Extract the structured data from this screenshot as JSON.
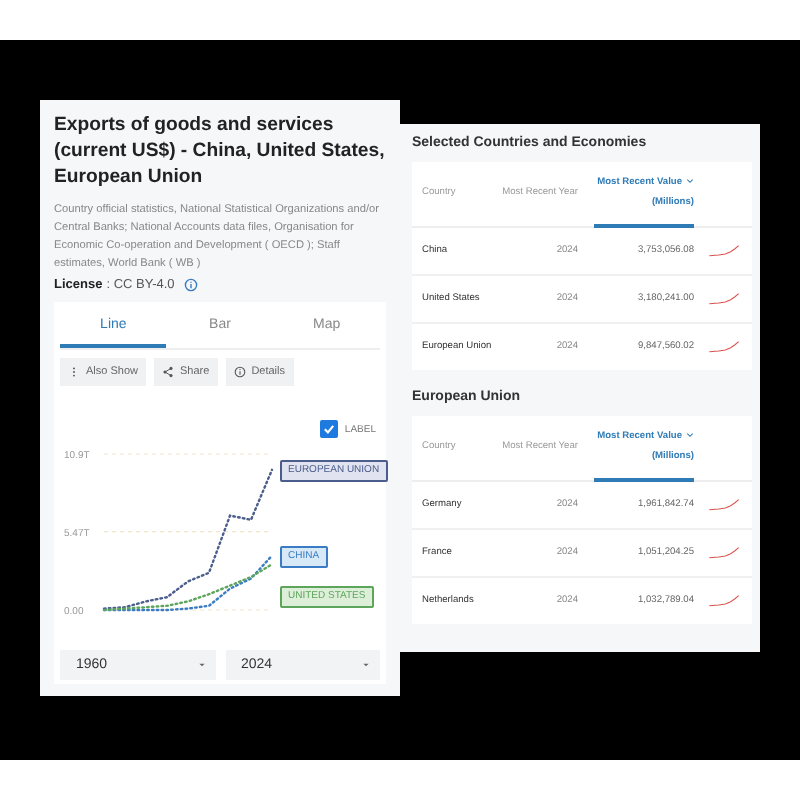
{
  "indicator": {
    "title": "Exports of goods and services (current US$) - China, United States, European Union",
    "source": "Country official statistics, National Statistical Organizations and/or Central Banks; National Accounts data files, Organisation for Economic Co-operation and Development ( OECD ); Staff estimates, World Bank ( WB )",
    "license_label": "License",
    "license_value": ": CC BY-4.0"
  },
  "view_tabs": [
    {
      "label": "Line",
      "selected": true
    },
    {
      "label": "Bar",
      "selected": false
    },
    {
      "label": "Map",
      "selected": false
    }
  ],
  "actions": [
    {
      "label": "Also Show",
      "kind": "more"
    },
    {
      "label": "Share",
      "kind": "share"
    },
    {
      "label": "Details",
      "kind": "details"
    }
  ],
  "label_toggle": {
    "label": "LABEL",
    "checked": true
  },
  "chart": {
    "chart_data": {
      "type": "line",
      "categories": [
        null,
        null,
        null,
        null,
        null,
        null,
        null,
        null,
        null
      ],
      "yticks": [
        {
          "value": 0,
          "label": "0.00"
        },
        {
          "value": 5.47,
          "label": "5.47T"
        },
        {
          "value": 10.9,
          "label": "10.9T"
        }
      ],
      "ylim": [
        0,
        10.9
      ],
      "series": [
        {
          "name": "EUROPEAN UNION",
          "color": "#4b5d8c",
          "line_style": "dotted",
          "values": [
            0.1,
            0.2,
            0.6,
            0.9,
            2.0,
            2.6,
            6.6,
            6.3,
            9.8
          ]
        },
        {
          "name": "CHINA",
          "color": "#3a7cc3",
          "line_style": "dotted",
          "values": [
            0.0,
            0.0,
            0.0,
            0.0,
            0.1,
            0.3,
            1.5,
            2.2,
            3.8
          ]
        },
        {
          "name": "UNITED STATES",
          "color": "#5ca55a",
          "line_style": "dotted",
          "values": [
            0.0,
            0.1,
            0.2,
            0.3,
            0.6,
            1.1,
            1.7,
            2.3,
            3.2
          ]
        }
      ]
    }
  },
  "range": {
    "start": "1960",
    "end": "2024"
  },
  "tables": [
    {
      "title": "Selected Countries and Economies",
      "columns": [
        {
          "label": "Country",
          "selected": false
        },
        {
          "label": "Most Recent Year",
          "selected": false
        },
        {
          "label": "Most Recent Value",
          "unit": "(Millions)",
          "selected": true
        }
      ],
      "rows": [
        {
          "country": "China",
          "year": "2024",
          "value": "3,753,056.08"
        },
        {
          "country": "United States",
          "year": "2024",
          "value": "3,180,241.00"
        },
        {
          "country": "European Union",
          "year": "2024",
          "value": "9,847,560.02"
        }
      ]
    },
    {
      "title": "European Union",
      "columns": [
        {
          "label": "Country",
          "selected": false
        },
        {
          "label": "Most Recent Year",
          "selected": false
        },
        {
          "label": "Most Recent Value",
          "unit": "(Millions)",
          "selected": true
        }
      ],
      "rows": [
        {
          "country": "Germany",
          "year": "2024",
          "value": "1,961,842.74"
        },
        {
          "country": "France",
          "year": "2024",
          "value": "1,051,204.25"
        },
        {
          "country": "Netherlands",
          "year": "2024",
          "value": "1,032,789.04"
        }
      ]
    }
  ]
}
